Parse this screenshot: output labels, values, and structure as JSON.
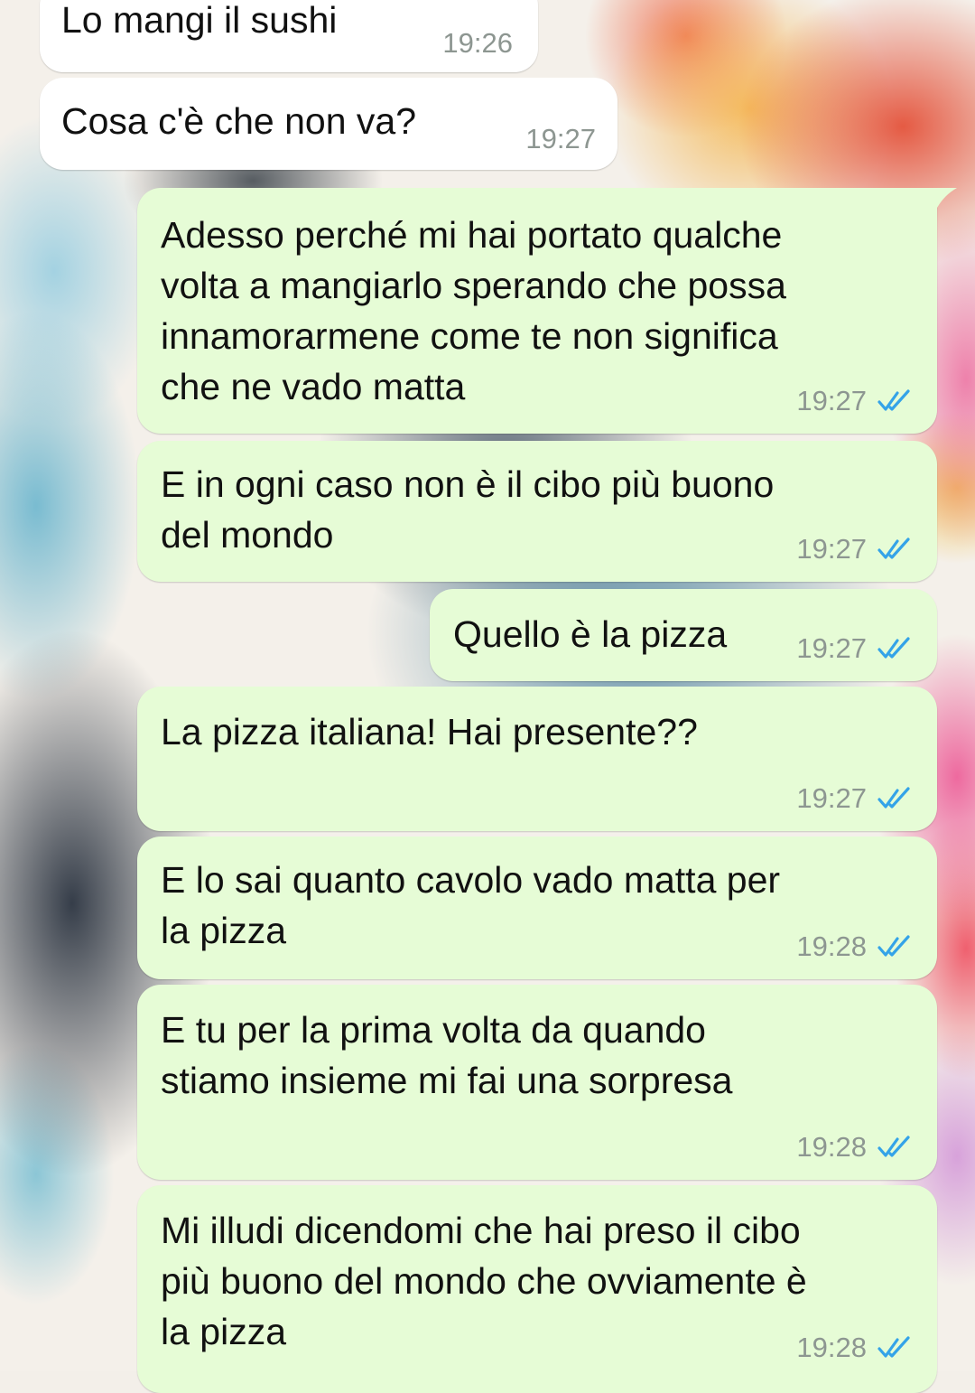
{
  "colors": {
    "incoming_bubble": "#ffffff",
    "outgoing_bubble": "#e6fcd6",
    "timestamp": "#8d9691",
    "read_ticks": "#34a3e8"
  },
  "messages": [
    {
      "direction": "in",
      "text": "Lo mangi il sushi",
      "time": "19:26"
    },
    {
      "direction": "in",
      "text": "Cosa c'è che non va?",
      "time": "19:27"
    },
    {
      "direction": "out",
      "text": "Adesso perché mi hai portato qualche\nvolta a mangiarlo sperando che possa\ninnamorarmene come te non significa\nche ne vado matta",
      "time": "19:27",
      "status": "read",
      "status_icon": "double-check-icon"
    },
    {
      "direction": "out",
      "text": "E in ogni caso non è il cibo più buono\ndel mondo",
      "time": "19:27",
      "status": "read",
      "status_icon": "double-check-icon"
    },
    {
      "direction": "out",
      "text": "Quello è la pizza",
      "time": "19:27",
      "status": "read",
      "status_icon": "double-check-icon"
    },
    {
      "direction": "out",
      "text": "La pizza italiana! Hai presente??",
      "time": "19:27",
      "status": "read",
      "status_icon": "double-check-icon"
    },
    {
      "direction": "out",
      "text": "E lo sai quanto cavolo vado matta per\nla pizza",
      "time": "19:28",
      "status": "read",
      "status_icon": "double-check-icon"
    },
    {
      "direction": "out",
      "text": "E tu per la prima volta da quando\nstiamo insieme mi fai una sorpresa",
      "time": "19:28",
      "status": "read",
      "status_icon": "double-check-icon"
    },
    {
      "direction": "out",
      "text": "Mi illudi dicendomi che hai preso il cibo\npiù buono del mondo che ovviamente è\nla pizza",
      "time": "19:28",
      "status": "read",
      "status_icon": "double-check-icon"
    }
  ]
}
